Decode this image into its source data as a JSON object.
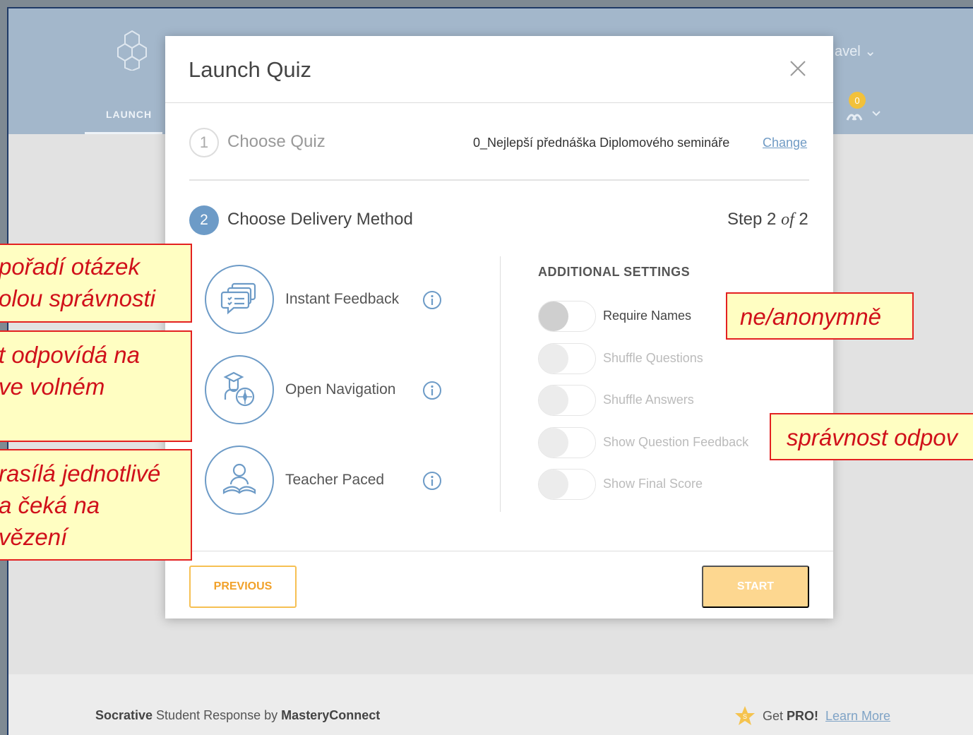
{
  "app": {
    "launch_tab": "LAUNCH",
    "user_menu": "avel ⌄",
    "rooms_badge": "0"
  },
  "modal": {
    "title": "Launch Quiz",
    "step1": {
      "number": "1",
      "label": "Choose Quiz",
      "quiz_name": "0_Nejlepší přednáška Diplomového semináře",
      "change_link": "Change"
    },
    "step2": {
      "number": "2",
      "label": "Choose Delivery Method",
      "step_prefix": "Step 2 ",
      "step_of": "of",
      "step_suffix": " 2"
    },
    "methods": [
      {
        "label": "Instant Feedback",
        "icon": "speech-bubbles-icon"
      },
      {
        "label": "Open Navigation",
        "icon": "compass-user-icon"
      },
      {
        "label": "Teacher Paced",
        "icon": "reader-book-icon"
      }
    ],
    "additional_settings_title": "ADDITIONAL SETTINGS",
    "settings": [
      {
        "label": "Require Names",
        "enabled": true
      },
      {
        "label": "Shuffle Questions",
        "enabled": false
      },
      {
        "label": "Shuffle Answers",
        "enabled": false
      },
      {
        "label": "Show Question Feedback",
        "enabled": false
      },
      {
        "label": "Show Final Score",
        "enabled": false
      }
    ],
    "previous_button": "PREVIOUS",
    "start_button": "START"
  },
  "footer": {
    "brand": "Socrative",
    "tagline": " Student Response by ",
    "company": "MasteryConnect",
    "get": "Get ",
    "pro": "PRO!",
    "learn_more": "Learn More"
  },
  "annotations": {
    "note1": [
      "pořadí otázek",
      "olou správnosti"
    ],
    "note2": [
      "t odpovídá na",
      " ve volném"
    ],
    "note3": [
      "rasílá jednotlivé",
      " a čeká na",
      "vězení"
    ],
    "note4": [
      "ne/anonymně"
    ],
    "note5": [
      "správnost odpov"
    ]
  },
  "colors": {
    "accent_blue": "#6d9bc7",
    "header_bg": "#a3b7cb",
    "orange": "#f1a12a",
    "annotation_red": "#d0101a",
    "annotation_bg": "#fffec2"
  }
}
